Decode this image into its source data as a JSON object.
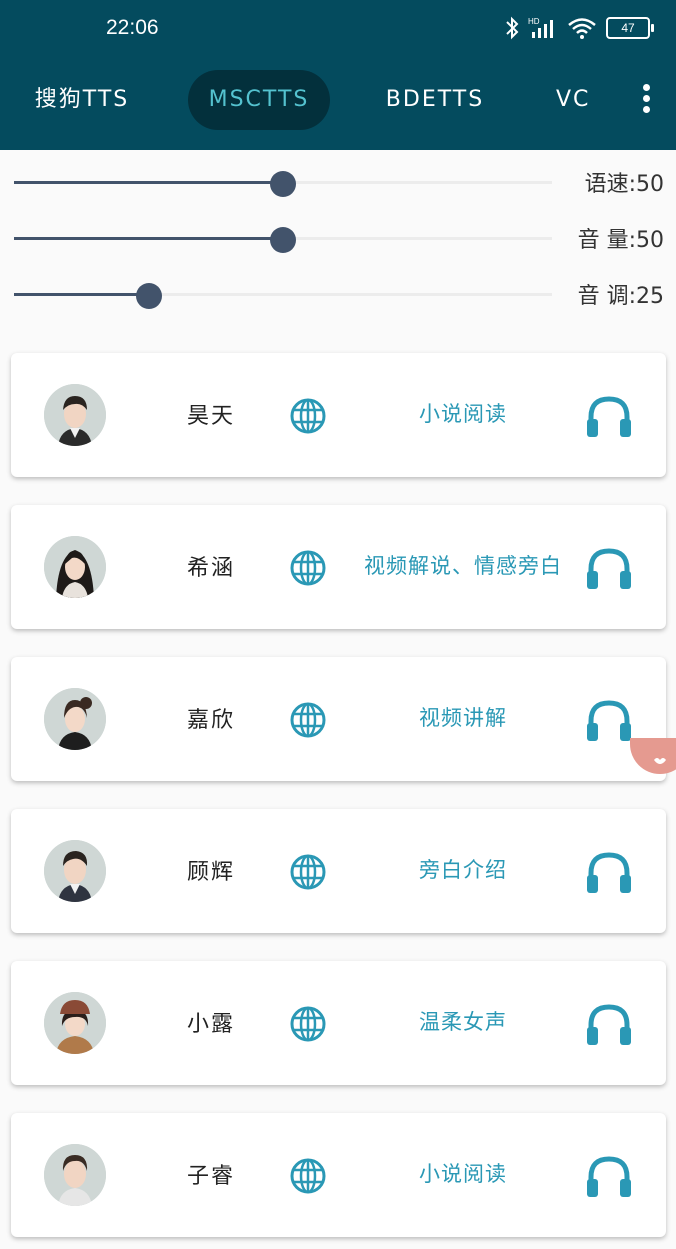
{
  "status_bar": {
    "time": "22:06",
    "battery": "47"
  },
  "tabs": [
    {
      "label": "搜狗TTS",
      "active": false
    },
    {
      "label": "MSCTTS",
      "active": true
    },
    {
      "label": "BDETTS",
      "active": false
    },
    {
      "label": "VC",
      "active": false
    }
  ],
  "sliders": [
    {
      "label": "语速:50",
      "value": 50
    },
    {
      "label": "音 量:50",
      "value": 50
    },
    {
      "label": "音 调:25",
      "value": 25
    }
  ],
  "voices": [
    {
      "name": "昊天",
      "description": "小说阅读",
      "avatar": "male-avatar"
    },
    {
      "name": "希涵",
      "description": "视频解说、情感旁白",
      "avatar": "female-avatar"
    },
    {
      "name": "嘉欣",
      "description": "视频讲解",
      "avatar": "female-avatar"
    },
    {
      "name": "顾辉",
      "description": "旁白介绍",
      "avatar": "male-avatar"
    },
    {
      "name": "小露",
      "description": "温柔女声",
      "avatar": "female-avatar"
    },
    {
      "name": "子睿",
      "description": "小说阅读",
      "avatar": "male-avatar"
    }
  ],
  "colors": {
    "appbar": "#044b5e",
    "active_tab_bg": "#03303c",
    "active_tab_text": "#54c2cf",
    "accent": "#2a98b5",
    "slider": "#42536b"
  }
}
